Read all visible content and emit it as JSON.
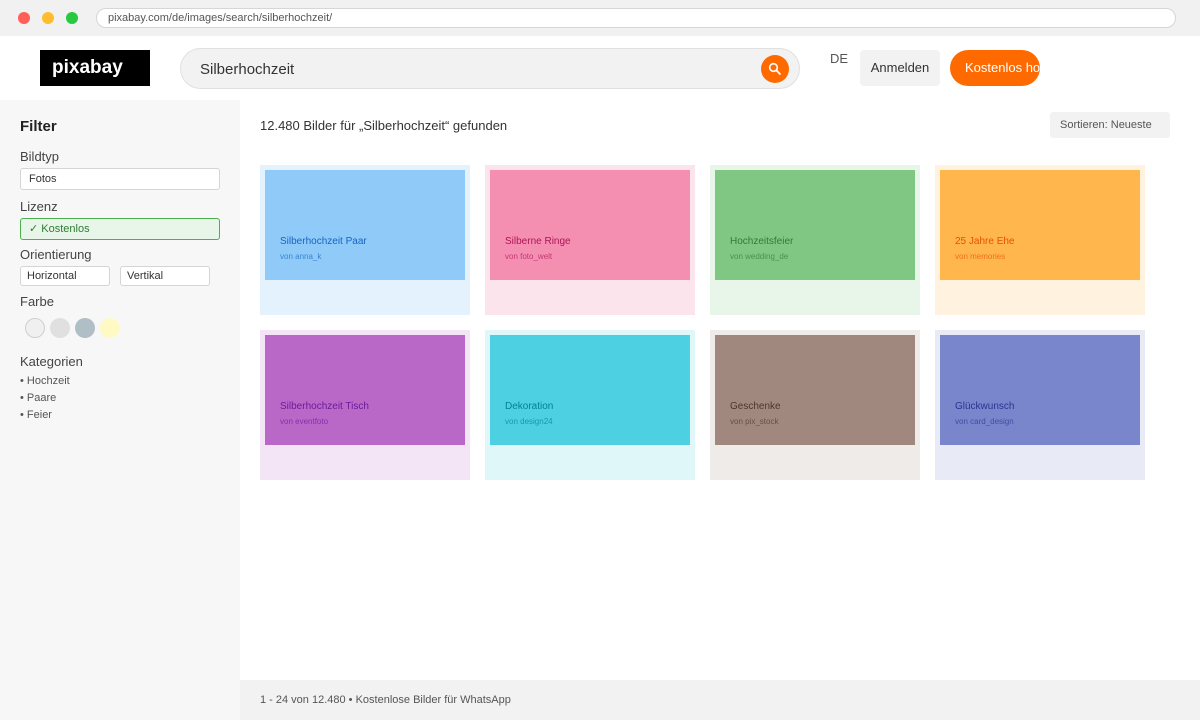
{
  "browser": {
    "url": "pixabay.com/de/images/search/silberhochzeit/"
  },
  "header": {
    "logo": "pixabay",
    "search_value": "Silberhochzeit",
    "lang": "DE",
    "login_label": "Anmelden",
    "join_label": "Kostenlos hoc"
  },
  "sidebar": {
    "title": "Filter",
    "bildtyp_label": "Bildtyp",
    "bildtyp_value": "Fotos",
    "lizenz_label": "Lizenz",
    "lizenz_value": "✓ Kostenlos",
    "orient_label": "Orientierung",
    "orient_horizontal": "Horizontal",
    "orient_vertical": "Vertikal",
    "farbe_label": "Farbe",
    "swatches": [
      "#f0f0f0",
      "#e0e0e0",
      "#b0bec5",
      "#fff9c4"
    ],
    "kategorien_label": "Kategorien",
    "categories": [
      "• Hochzeit",
      "• Paare",
      "• Feier"
    ]
  },
  "main": {
    "result_count": "12.480 Bilder für „Silberhochzeit“ gefunden",
    "sort_label": "Sortieren: Neueste",
    "cards": [
      {
        "title": "Silberhochzeit Paar",
        "author": "von anna_k",
        "bg": "#e3f2fd",
        "img": "#90caf9",
        "text": "#1565c0"
      },
      {
        "title": "Silberne Ringe",
        "author": "von foto_welt",
        "bg": "#fce4ec",
        "img": "#f48fb1",
        "text": "#ad1457"
      },
      {
        "title": "Hochzeitsfeier",
        "author": "von wedding_de",
        "bg": "#e8f5e9",
        "img": "#81c784",
        "text": "#2e7d32"
      },
      {
        "title": "25 Jahre Ehe",
        "author": "von memories",
        "bg": "#fff3e0",
        "img": "#ffb74d",
        "text": "#e65100"
      },
      {
        "title": "Silberhochzeit Tisch",
        "author": "von eventfoto",
        "bg": "#f3e5f5",
        "img": "#ba68c8",
        "text": "#6a1b9a"
      },
      {
        "title": "Dekoration",
        "author": "von design24",
        "bg": "#e0f7fa",
        "img": "#4dd0e1",
        "text": "#00838f"
      },
      {
        "title": "Geschenke",
        "author": "von pix_stock",
        "bg": "#efebe9",
        "img": "#a1887f",
        "text": "#4e342e"
      },
      {
        "title": "Glückwunsch",
        "author": "von card_design",
        "bg": "#e8eaf6",
        "img": "#7986cb",
        "text": "#283593"
      }
    ]
  },
  "footer": {
    "text": "1 - 24 von 12.480 • Kostenlose Bilder für WhatsApp"
  }
}
